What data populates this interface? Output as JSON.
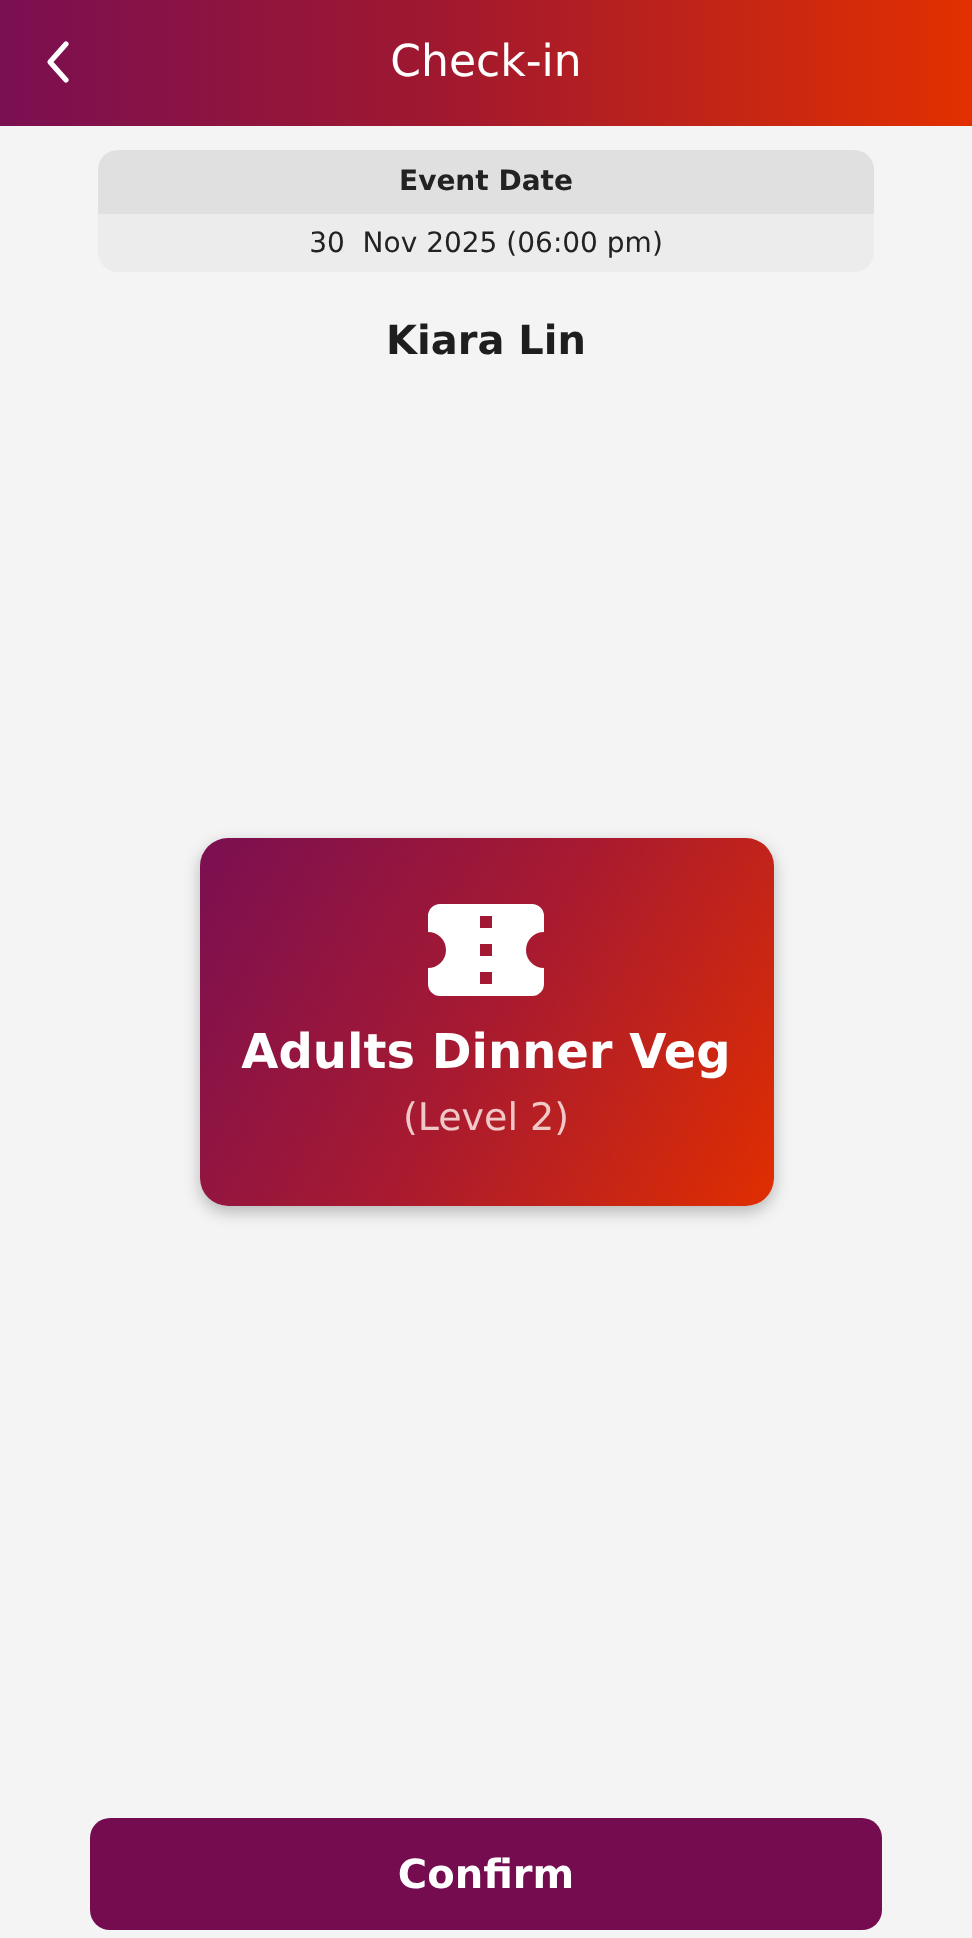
{
  "header": {
    "title": "Check-in"
  },
  "event_date": {
    "label": "Event Date",
    "value": "30  Nov 2025 (06:00 pm)"
  },
  "attendee": {
    "name": "Kiara Lin"
  },
  "ticket": {
    "title": "Adults Dinner Veg",
    "level": "(Level 2)"
  },
  "confirm_button": {
    "label": "Confirm"
  }
}
